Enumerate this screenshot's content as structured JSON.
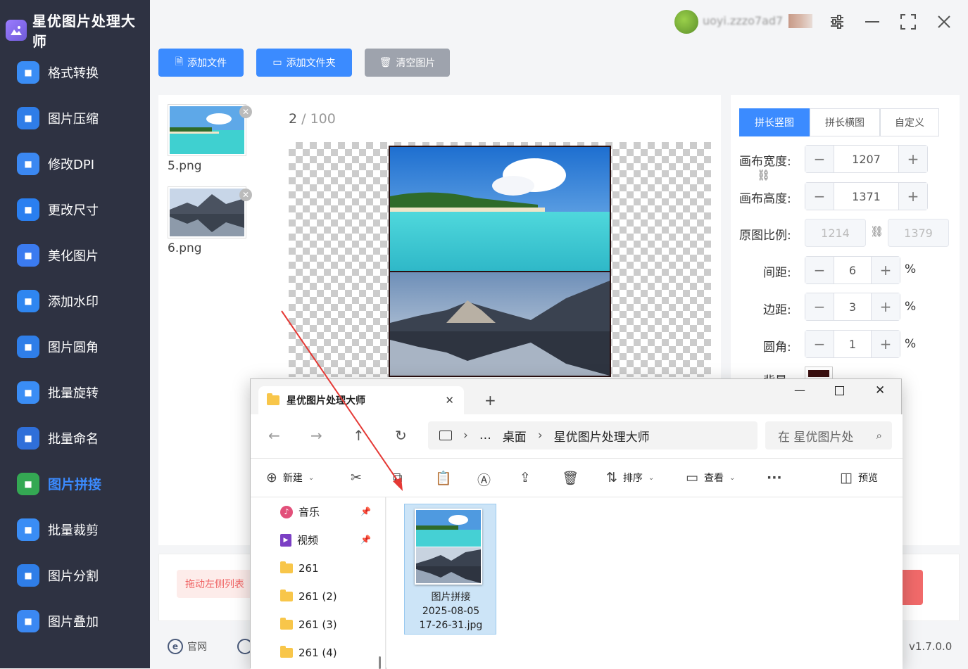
{
  "app": {
    "title": "星优图片处理大师",
    "version": "v1.7.0.0"
  },
  "user": {
    "name": "uoyi.zzzo7ad7"
  },
  "sidebar": {
    "items": [
      {
        "label": "格式转换",
        "icon": "format-convert-icon",
        "color": "#3a8df5"
      },
      {
        "label": "图片压缩",
        "icon": "compress-icon",
        "color": "#2f7de8"
      },
      {
        "label": "修改DPI",
        "icon": "dpi-icon",
        "color": "#3b88f2"
      },
      {
        "label": "更改尺寸",
        "icon": "resize-icon",
        "color": "#2a7ff0"
      },
      {
        "label": "美化图片",
        "icon": "beautify-icon",
        "color": "#3b7bf0"
      },
      {
        "label": "添加水印",
        "icon": "watermark-icon",
        "color": "#2f86f0"
      },
      {
        "label": "图片圆角",
        "icon": "round-corner-icon",
        "color": "#2f7ee8"
      },
      {
        "label": "批量旋转",
        "icon": "rotate-icon",
        "color": "#3a8df5"
      },
      {
        "label": "批量命名",
        "icon": "rename-icon",
        "color": "#2f6fd9"
      },
      {
        "label": "图片拼接",
        "icon": "splice-icon",
        "color": "#34a853",
        "active": true
      },
      {
        "label": "批量裁剪",
        "icon": "crop-icon",
        "color": "#3a8df5"
      },
      {
        "label": "图片分割",
        "icon": "split-icon",
        "color": "#2f7ee8"
      },
      {
        "label": "图片叠加",
        "icon": "overlay-icon",
        "color": "#3b88f2"
      }
    ]
  },
  "toolbar": {
    "add_file": "添加文件",
    "add_folder": "添加文件夹",
    "clear": "清空图片"
  },
  "files": [
    {
      "name": "5.png"
    },
    {
      "name": "6.png"
    }
  ],
  "counter": {
    "current": "2",
    "sep": " / ",
    "max": "100"
  },
  "settings": {
    "tabs": [
      "拼长竖图",
      "拼长横图",
      "自定义"
    ],
    "canvas_width_label": "画布宽度:",
    "canvas_width": "1207",
    "canvas_height_label": "画布高度:",
    "canvas_height": "1371",
    "ratio_label": "原图比例:",
    "ratio_w": "1214",
    "ratio_h": "1379",
    "spacing_label": "间距:",
    "spacing": "6",
    "margin_label": "边距:",
    "margin": "3",
    "radius_label": "圆角:",
    "radius": "1",
    "bg_label": "背景:",
    "bg_color": "#3a0f0f",
    "percent": "%"
  },
  "bottom": {
    "hint": "拖动左侧列表",
    "website": "官网"
  },
  "explorer": {
    "tab_title": "星优图片处理大师",
    "breadcrumb": [
      "…",
      "桌面",
      "星优图片处理大师"
    ],
    "search_placeholder": "在 星优图片处",
    "commands": {
      "new": "新建",
      "sort": "排序",
      "view": "查看",
      "preview": "预览"
    },
    "sidebar": [
      {
        "label": "音乐",
        "type": "music"
      },
      {
        "label": "视频",
        "type": "video"
      },
      {
        "label": "261",
        "type": "folder"
      },
      {
        "label": "261 (2)",
        "type": "folder"
      },
      {
        "label": "261 (3)",
        "type": "folder"
      },
      {
        "label": "261 (4)",
        "type": "folder"
      }
    ],
    "file": {
      "line1": "图片拼接",
      "line2": "2025-08-05",
      "line3": "17-26-31.jpg"
    }
  }
}
